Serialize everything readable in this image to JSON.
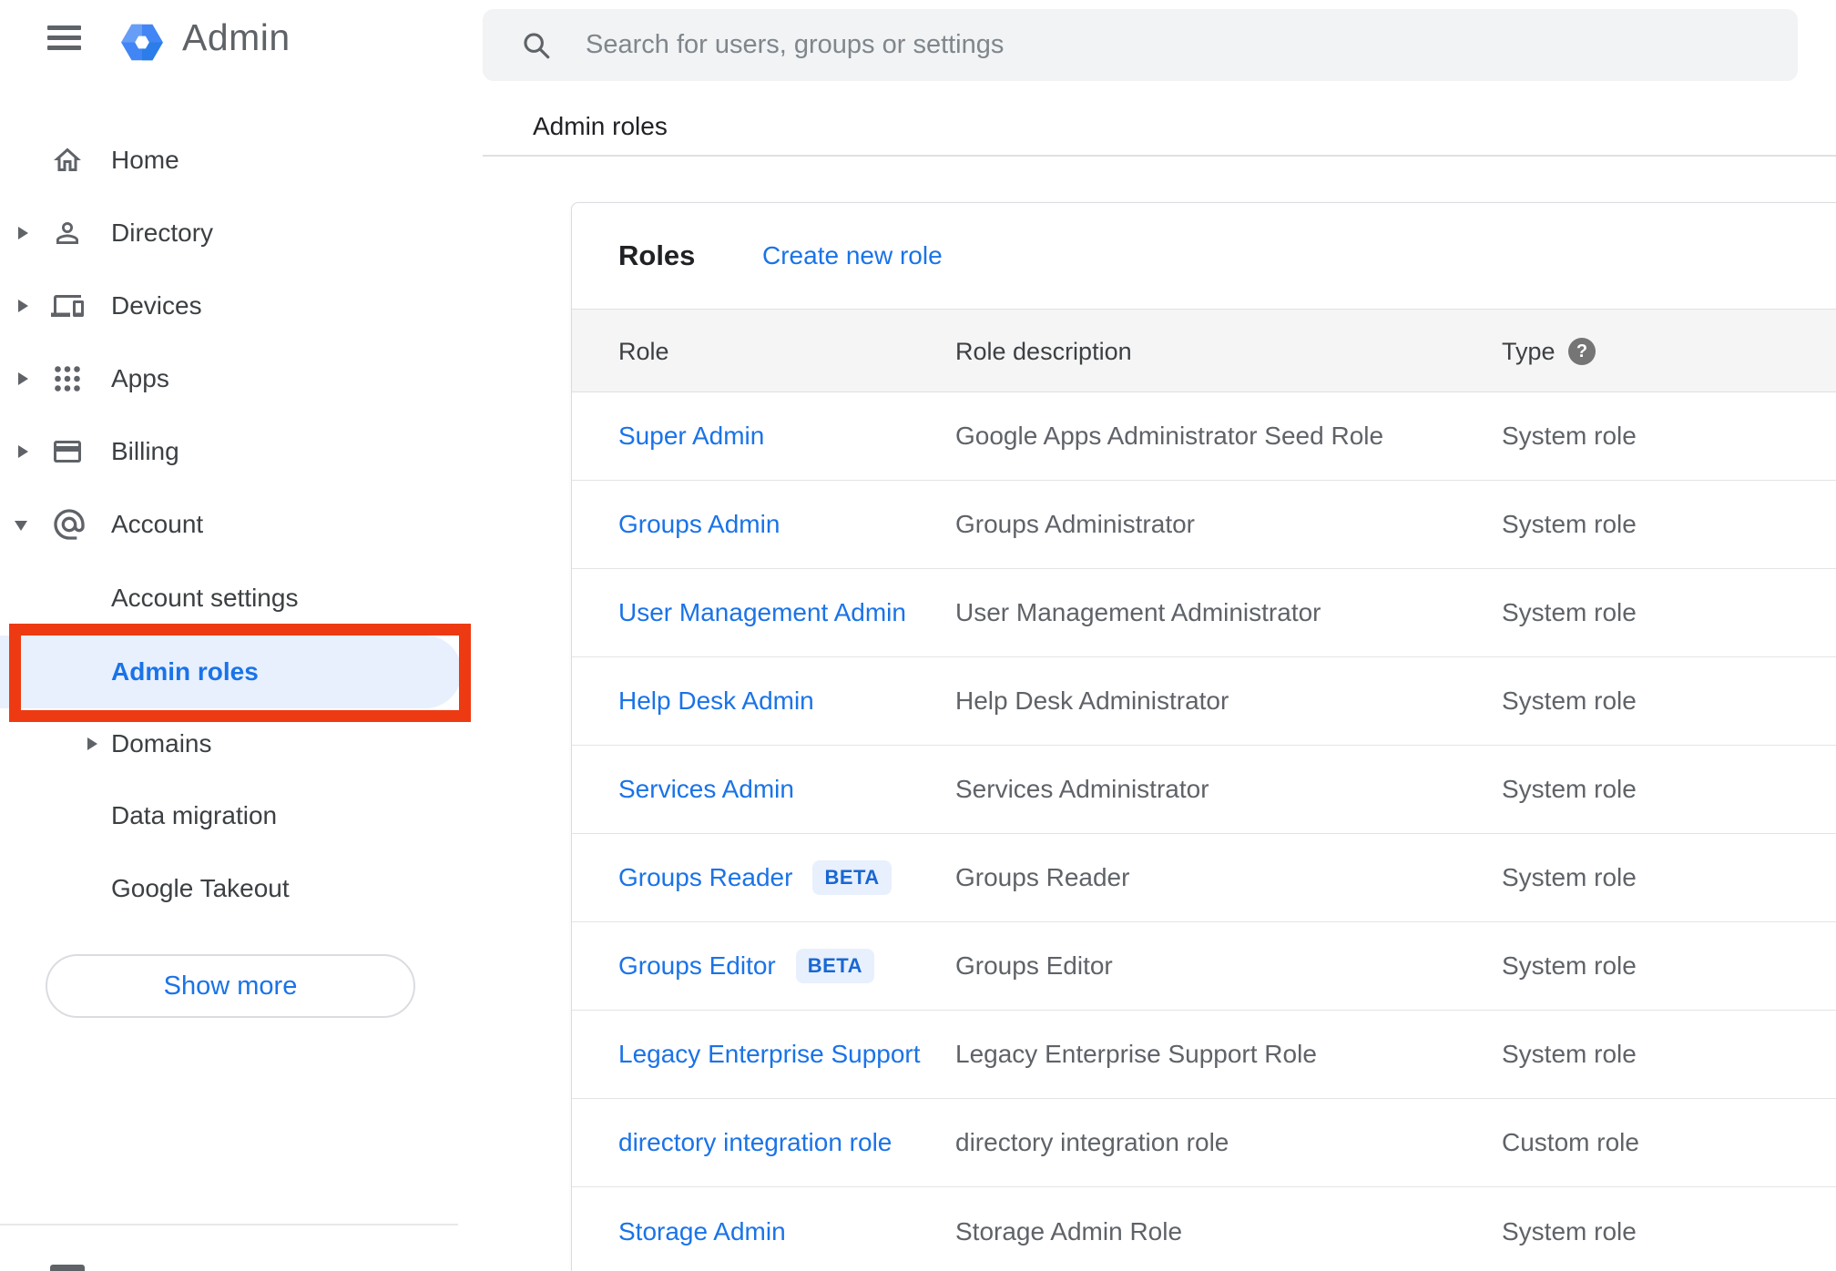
{
  "app": {
    "title": "Admin"
  },
  "search": {
    "placeholder": "Search for users, groups or settings"
  },
  "breadcrumb": "Admin roles",
  "sidebar": {
    "items": [
      {
        "label": "Home"
      },
      {
        "label": "Directory"
      },
      {
        "label": "Devices"
      },
      {
        "label": "Apps"
      },
      {
        "label": "Billing"
      },
      {
        "label": "Account"
      }
    ],
    "account_children": [
      {
        "label": "Account settings"
      },
      {
        "label": "Admin roles"
      },
      {
        "label": "Domains"
      },
      {
        "label": "Data migration"
      },
      {
        "label": "Google Takeout"
      }
    ],
    "show_more_label": "Show more"
  },
  "panel": {
    "title": "Roles",
    "create_link": "Create new role"
  },
  "icons": {
    "help": "?"
  },
  "table": {
    "headers": {
      "role": "Role",
      "description": "Role description",
      "type": "Type"
    },
    "rows": [
      {
        "role": "Super Admin",
        "description": "Google Apps Administrator Seed Role",
        "type": "System role"
      },
      {
        "role": "Groups Admin",
        "description": "Groups Administrator",
        "type": "System role"
      },
      {
        "role": "User Management Admin",
        "description": "User Management Administrator",
        "type": "System role"
      },
      {
        "role": "Help Desk Admin",
        "description": "Help Desk Administrator",
        "type": "System role"
      },
      {
        "role": "Services Admin",
        "description": "Services Administrator",
        "type": "System role"
      },
      {
        "role": "Groups Reader",
        "badge": "BETA",
        "description": "Groups Reader",
        "type": "System role"
      },
      {
        "role": "Groups Editor",
        "badge": "BETA",
        "description": "Groups Editor",
        "type": "System role"
      },
      {
        "role": "Legacy Enterprise Support",
        "description": "Legacy Enterprise Support Role",
        "type": "System role"
      },
      {
        "role": "directory integration role",
        "description": "directory integration role",
        "type": "Custom role"
      },
      {
        "role": "Storage Admin",
        "description": "Storage Admin Role",
        "type": "System role"
      }
    ]
  },
  "colors": {
    "accent": "#1a73e8",
    "annotation_red": "#ee3a12",
    "selected_bg": "#e8f0fe",
    "badge_bg": "#e8f0fe",
    "badge_text": "#1967d2"
  }
}
